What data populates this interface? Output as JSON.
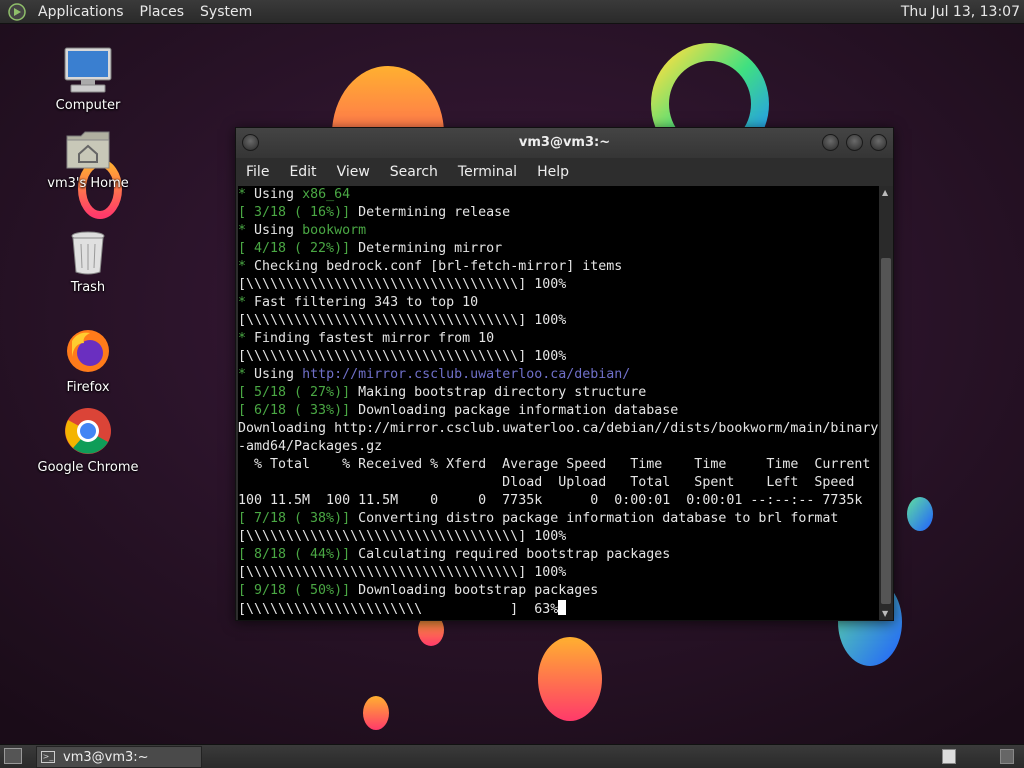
{
  "top_panel": {
    "menus": [
      "Applications",
      "Places",
      "System"
    ],
    "clock": "Thu Jul 13, 13:07"
  },
  "desktop": {
    "icons": [
      {
        "label": "Computer",
        "icon": "computer-icon"
      },
      {
        "label": "vm3's Home",
        "icon": "home-folder-icon"
      },
      {
        "label": "Trash",
        "icon": "trash-icon"
      },
      {
        "label": "Firefox",
        "icon": "firefox-icon"
      },
      {
        "label": "Google Chrome",
        "icon": "chrome-icon"
      }
    ]
  },
  "terminal": {
    "title": "vm3@vm3:~",
    "menu": [
      "File",
      "Edit",
      "View",
      "Search",
      "Terminal",
      "Help"
    ],
    "lines": [
      {
        "segments": [
          {
            "t": "* ",
            "c": "g"
          },
          {
            "t": "Using ",
            "c": ""
          },
          {
            "t": "x86_64",
            "c": "g"
          }
        ]
      },
      {
        "segments": [
          {
            "t": "[ 3/18 ( 16%)]",
            "c": "g"
          },
          {
            "t": " Determining release",
            "c": ""
          }
        ]
      },
      {
        "segments": [
          {
            "t": "* ",
            "c": "g"
          },
          {
            "t": "Using ",
            "c": ""
          },
          {
            "t": "bookworm",
            "c": "g"
          }
        ]
      },
      {
        "segments": [
          {
            "t": "[ 4/18 ( 22%)]",
            "c": "g"
          },
          {
            "t": " Determining mirror",
            "c": ""
          }
        ]
      },
      {
        "segments": [
          {
            "t": "* ",
            "c": "g"
          },
          {
            "t": "Checking bedrock.conf [brl-fetch-mirror] items",
            "c": ""
          }
        ]
      },
      {
        "segments": [
          {
            "t": "[\\\\\\\\\\\\\\\\\\\\\\\\\\\\\\\\\\\\\\\\\\\\\\\\\\\\\\\\\\\\\\\\\\\\] 100%",
            "c": ""
          }
        ]
      },
      {
        "segments": [
          {
            "t": "* ",
            "c": "g"
          },
          {
            "t": "Fast filtering 343 to top 10",
            "c": ""
          }
        ]
      },
      {
        "segments": [
          {
            "t": "[\\\\\\\\\\\\\\\\\\\\\\\\\\\\\\\\\\\\\\\\\\\\\\\\\\\\\\\\\\\\\\\\\\\\] 100%",
            "c": ""
          }
        ]
      },
      {
        "segments": [
          {
            "t": "* ",
            "c": "g"
          },
          {
            "t": "Finding fastest mirror from 10",
            "c": ""
          }
        ]
      },
      {
        "segments": [
          {
            "t": "[\\\\\\\\\\\\\\\\\\\\\\\\\\\\\\\\\\\\\\\\\\\\\\\\\\\\\\\\\\\\\\\\\\\\] 100%",
            "c": ""
          }
        ]
      },
      {
        "segments": [
          {
            "t": "* ",
            "c": "g"
          },
          {
            "t": "Using ",
            "c": ""
          },
          {
            "t": "http://mirror.csclub.uwaterloo.ca/debian/",
            "c": "p"
          }
        ]
      },
      {
        "segments": [
          {
            "t": "[ 5/18 ( 27%)]",
            "c": "g"
          },
          {
            "t": " Making bootstrap directory structure",
            "c": ""
          }
        ]
      },
      {
        "segments": [
          {
            "t": "[ 6/18 ( 33%)]",
            "c": "g"
          },
          {
            "t": " Downloading package information database",
            "c": ""
          }
        ]
      },
      {
        "segments": [
          {
            "t": "Downloading http://mirror.csclub.uwaterloo.ca/debian//dists/bookworm/main/binary",
            "c": ""
          }
        ]
      },
      {
        "segments": [
          {
            "t": "-amd64/Packages.gz",
            "c": ""
          }
        ]
      },
      {
        "segments": [
          {
            "t": "  % Total    % Received % Xferd  Average Speed   Time    Time     Time  Current",
            "c": ""
          }
        ]
      },
      {
        "segments": [
          {
            "t": "                                 Dload  Upload   Total   Spent    Left  Speed",
            "c": ""
          }
        ]
      },
      {
        "segments": [
          {
            "t": "100 11.5M  100 11.5M    0     0  7735k      0  0:00:01  0:00:01 --:--:-- 7735k",
            "c": ""
          }
        ]
      },
      {
        "segments": [
          {
            "t": "[ 7/18 ( 38%)]",
            "c": "g"
          },
          {
            "t": " Converting distro package information database to brl format",
            "c": ""
          }
        ]
      },
      {
        "segments": [
          {
            "t": "[\\\\\\\\\\\\\\\\\\\\\\\\\\\\\\\\\\\\\\\\\\\\\\\\\\\\\\\\\\\\\\\\\\\\] 100%",
            "c": ""
          }
        ]
      },
      {
        "segments": [
          {
            "t": "[ 8/18 ( 44%)]",
            "c": "g"
          },
          {
            "t": " Calculating required bootstrap packages",
            "c": ""
          }
        ]
      },
      {
        "segments": [
          {
            "t": "[\\\\\\\\\\\\\\\\\\\\\\\\\\\\\\\\\\\\\\\\\\\\\\\\\\\\\\\\\\\\\\\\\\\\] 100%",
            "c": ""
          }
        ]
      },
      {
        "segments": [
          {
            "t": "[ 9/18 ( 50%)]",
            "c": "g"
          },
          {
            "t": " Downloading bootstrap packages",
            "c": ""
          }
        ]
      },
      {
        "segments": [
          {
            "t": "[\\\\\\\\\\\\\\\\\\\\\\\\\\\\\\\\\\\\\\\\\\\\           ]  63%",
            "c": ""
          }
        ]
      }
    ]
  },
  "bottom_panel": {
    "taskbar_item": "vm3@vm3:~"
  },
  "colors": {
    "terminal_green": "#4aa844",
    "terminal_url": "#6f6fc8",
    "wallpaper": "#22101f"
  }
}
